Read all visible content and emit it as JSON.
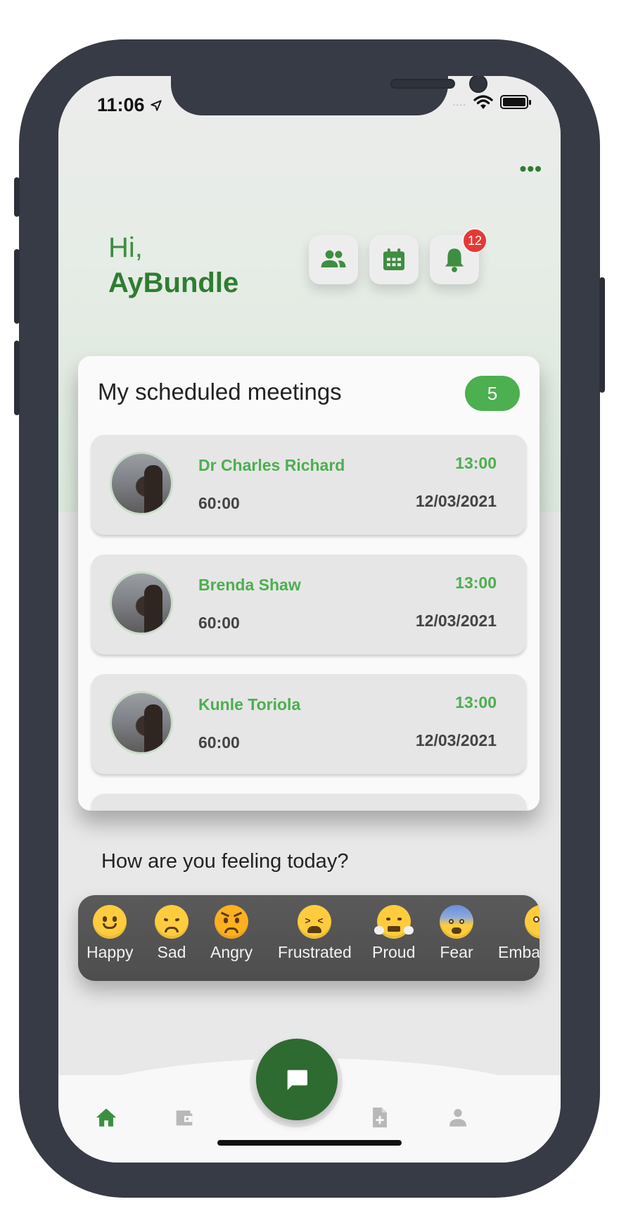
{
  "status_bar": {
    "time": "11:06",
    "signal_dots": "...."
  },
  "header": {
    "more_menu": "•••",
    "greeting": "Hi,",
    "user_name": "AyBundle"
  },
  "header_actions": [
    {
      "icon": "people-icon"
    },
    {
      "icon": "calendar-icon"
    },
    {
      "icon": "bell-icon",
      "badge": "12"
    }
  ],
  "meetings": {
    "title": "My scheduled meetings",
    "count": "5",
    "items": [
      {
        "name": "Dr Charles Richard",
        "time": "13:00",
        "duration": "60:00",
        "date": "12/03/2021"
      },
      {
        "name": "Brenda Shaw",
        "time": "13:00",
        "duration": "60:00",
        "date": "12/03/2021"
      },
      {
        "name": "Kunle Toriola",
        "time": "13:00",
        "duration": "60:00",
        "date": "12/03/2021"
      }
    ]
  },
  "mood": {
    "question": "How are you feeling today?",
    "options": [
      {
        "label": "Happy",
        "icon": "happy-emoji"
      },
      {
        "label": "Sad",
        "icon": "sad-emoji"
      },
      {
        "label": "Angry",
        "icon": "angry-emoji"
      },
      {
        "label": "Frustrated",
        "icon": "frustrated-emoji"
      },
      {
        "label": "Proud",
        "icon": "proud-emoji"
      },
      {
        "label": "Fear",
        "icon": "fear-emoji"
      },
      {
        "label": "Embar",
        "icon": "embarrassed-emoji"
      }
    ]
  },
  "bottom_nav": {
    "items": [
      {
        "icon": "home-icon",
        "active": true
      },
      {
        "icon": "wallet-icon",
        "active": false
      },
      {
        "icon": "chat-icon",
        "active": false
      },
      {
        "icon": "document-add-icon",
        "active": false
      },
      {
        "icon": "person-icon",
        "active": false
      }
    ]
  },
  "colors": {
    "primary": "#2e7d32",
    "accent": "#4caf50",
    "badge": "#e53935"
  }
}
